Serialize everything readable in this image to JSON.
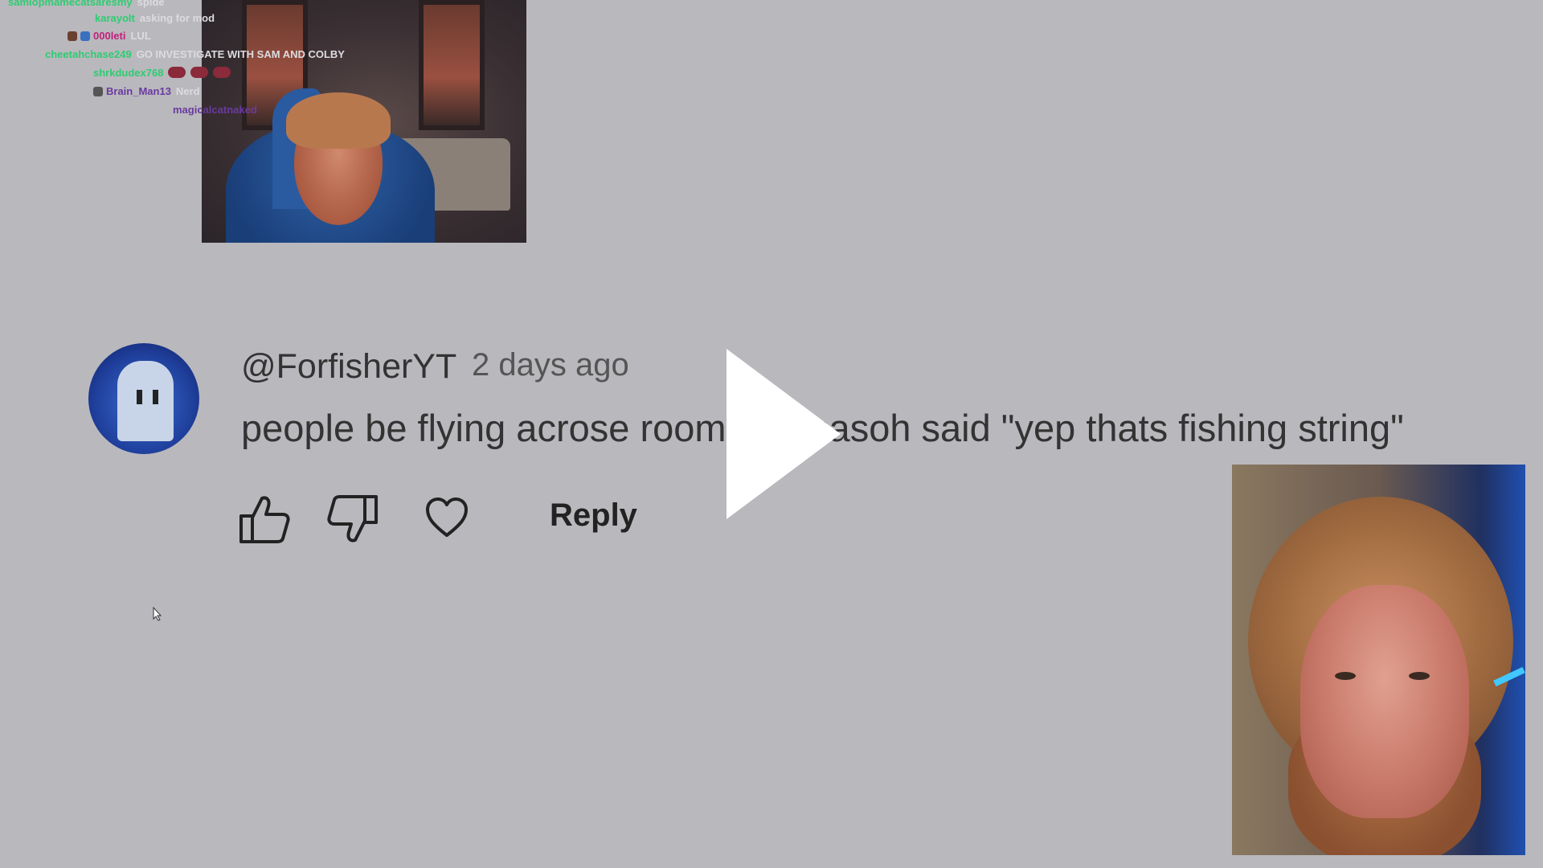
{
  "chat": {
    "lines": [
      {
        "user": "samiopmamecatsaresmy",
        "msg": "spide",
        "color": "#2ecc71"
      },
      {
        "user": "karayolt",
        "msg": "asking for mod",
        "color": "#2ecc71"
      },
      {
        "user": "000leti",
        "msg": "LUL",
        "color": "#c0207a"
      },
      {
        "user": "cheetahchase249",
        "msg": "GO INVESTIGATE WITH SAM AND COLBY",
        "color": "#2ecc71"
      },
      {
        "user": "shrkdudex768",
        "msg": "",
        "color": "#2ecc71"
      },
      {
        "user": "Brain_Man13",
        "msg": "Nerd",
        "color": "#6a3aa0"
      },
      {
        "user": "magicalcatnaked",
        "msg": "",
        "color": "#6a3aa0"
      }
    ]
  },
  "comment": {
    "handle": "@ForfisherYT",
    "time": "2 days ago",
    "text": "people be flying acrose room and casoh said \"yep thats fishing string\"",
    "reply_label": "Reply"
  },
  "icons": {
    "like": "thumbs-up-icon",
    "dislike": "thumbs-down-icon",
    "heart": "heart-icon",
    "play": "play-icon"
  },
  "colors": {
    "background": "#b9b8bd",
    "play": "#ffffff"
  }
}
